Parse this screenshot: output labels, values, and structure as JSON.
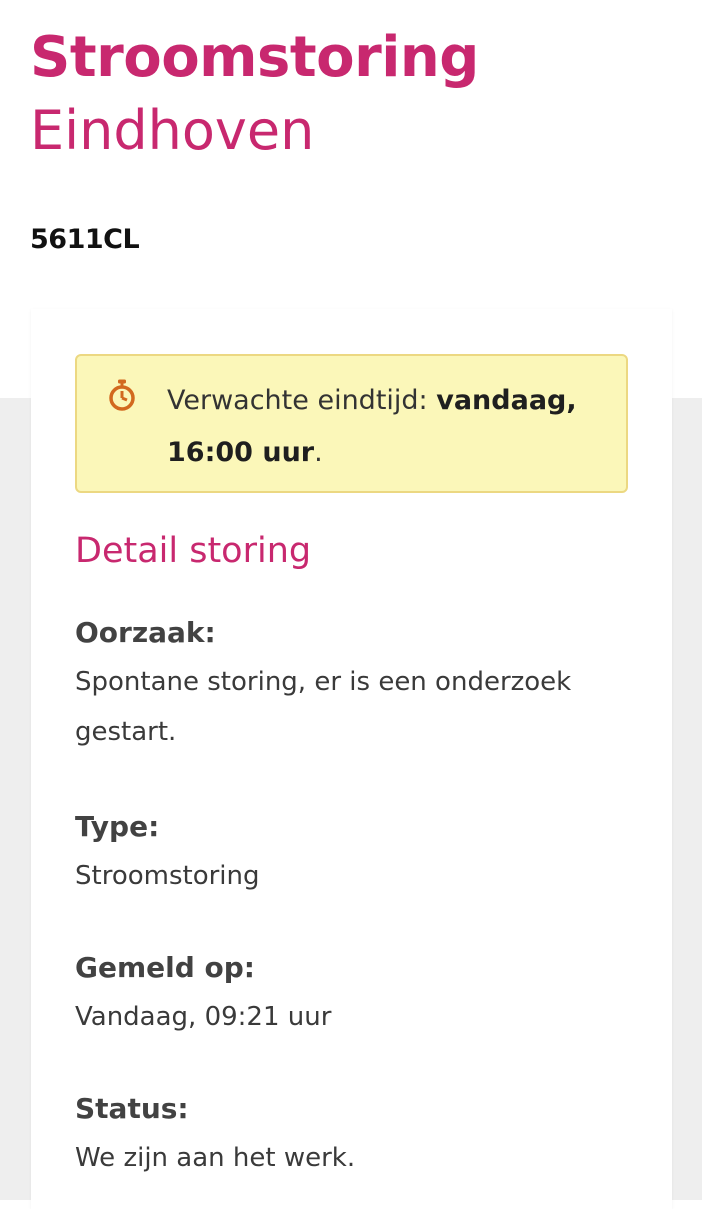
{
  "colors": {
    "brand": "#c8286f",
    "notice_background": "#fbf7b9",
    "notice_border": "#ecd882",
    "timer_icon": "#d2691e"
  },
  "header": {
    "title": "Stroomstoring",
    "city": "Eindhoven",
    "postcode": "5611CL"
  },
  "notice": {
    "icon": "timer-icon",
    "label": "Verwachte eindtijd:",
    "time_strong": "vandaag, 16:00 uur",
    "suffix": "."
  },
  "details": {
    "title": "Detail storing",
    "cause": {
      "label": "Oorzaak:",
      "value": "Spontane storing, er is een onderzoek gestart."
    },
    "type": {
      "label": "Type:",
      "value": "Stroomstoring"
    },
    "reported": {
      "label": "Gemeld op:",
      "value": "Vandaag, 09:21 uur"
    },
    "status": {
      "label": "Status:",
      "value": "We zijn aan het werk."
    }
  }
}
